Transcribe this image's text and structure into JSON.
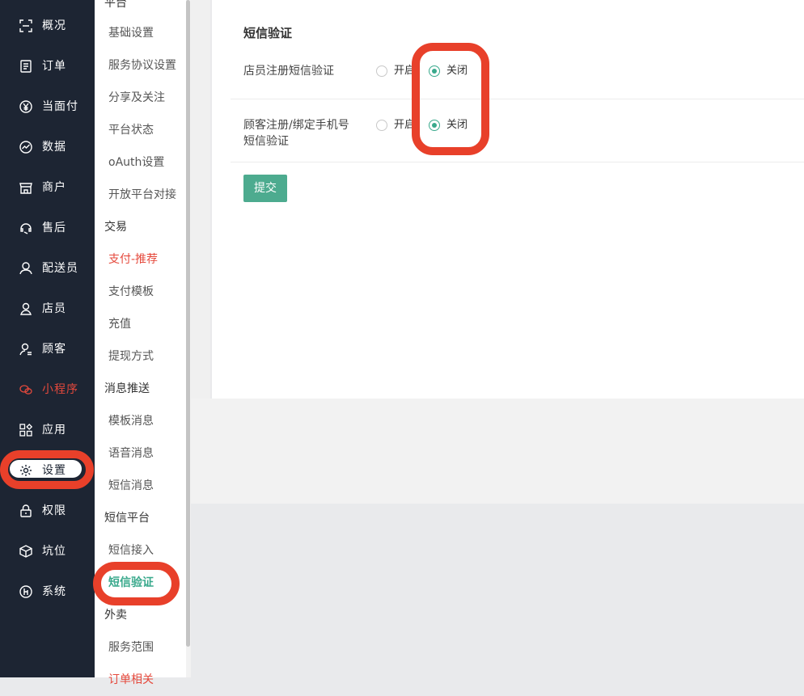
{
  "sidebar": {
    "items": [
      {
        "label": "概况",
        "icon": "scan-icon"
      },
      {
        "label": "订单",
        "icon": "order-list-icon"
      },
      {
        "label": "当面付",
        "icon": "yuan-icon"
      },
      {
        "label": "数据",
        "icon": "chart-line-icon"
      },
      {
        "label": "商户",
        "icon": "store-icon"
      },
      {
        "label": "售后",
        "icon": "headset-icon"
      },
      {
        "label": "配送员",
        "icon": "courier-user-icon"
      },
      {
        "label": "店员",
        "icon": "clerk-user-icon"
      },
      {
        "label": "顾客",
        "icon": "customer-user-icon"
      },
      {
        "label": "小程序",
        "icon": "wechat-icon"
      },
      {
        "label": "应用",
        "icon": "apps-grid-icon"
      },
      {
        "label": "设置",
        "icon": "gear-icon"
      },
      {
        "label": "权限",
        "icon": "lock-icon"
      },
      {
        "label": "坑位",
        "icon": "box-icon"
      },
      {
        "label": "系统",
        "icon": "system-icon"
      }
    ]
  },
  "submenu": {
    "items": [
      {
        "label": "平台",
        "kind": "group"
      },
      {
        "label": "基础设置",
        "kind": "child"
      },
      {
        "label": "服务协议设置",
        "kind": "child"
      },
      {
        "label": "分享及关注",
        "kind": "child"
      },
      {
        "label": "平台状态",
        "kind": "child"
      },
      {
        "label": "oAuth设置",
        "kind": "child"
      },
      {
        "label": "开放平台对接",
        "kind": "child"
      },
      {
        "label": "交易",
        "kind": "group"
      },
      {
        "label": "支付-推荐",
        "kind": "child"
      },
      {
        "label": "支付模板",
        "kind": "child"
      },
      {
        "label": "充值",
        "kind": "child"
      },
      {
        "label": "提现方式",
        "kind": "child"
      },
      {
        "label": "消息推送",
        "kind": "group"
      },
      {
        "label": "模板消息",
        "kind": "child"
      },
      {
        "label": "语音消息",
        "kind": "child"
      },
      {
        "label": "短信消息",
        "kind": "child"
      },
      {
        "label": "短信平台",
        "kind": "group"
      },
      {
        "label": "短信接入",
        "kind": "child"
      },
      {
        "label": "短信验证",
        "kind": "child"
      },
      {
        "label": "外卖",
        "kind": "group"
      },
      {
        "label": "服务范围",
        "kind": "child"
      },
      {
        "label": "订单相关",
        "kind": "child"
      }
    ]
  },
  "content": {
    "section_title": "短信验证",
    "rows": [
      {
        "label": "店员注册短信验证",
        "option_on": "开启",
        "option_off": "关闭",
        "selected": "关闭"
      },
      {
        "label_line1": "顾客注册/绑定手机号",
        "label_line2": "短信验证",
        "option_on": "开启",
        "option_off": "关闭",
        "selected": "关闭"
      }
    ],
    "submit_label": "提交"
  },
  "colors": {
    "sidebar_bg": "#1d2533",
    "accent": "#39a98c",
    "alert": "#e5493c",
    "annotation": "#e8402a"
  }
}
